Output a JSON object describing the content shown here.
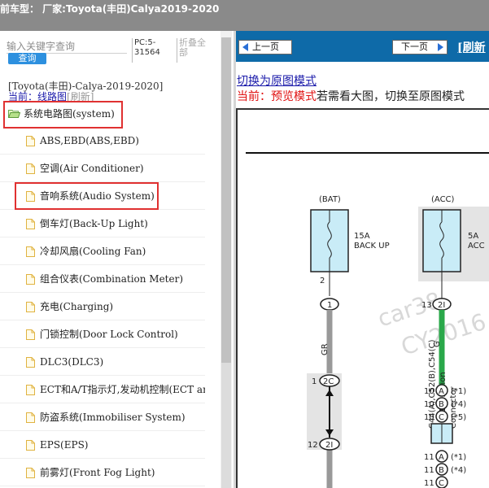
{
  "topbar": {
    "title": "前车型：  厂家:Toyota(丰田)Calya2019-2020"
  },
  "sidebar": {
    "search_placeholder": "输入关键字查询",
    "search_button": "查询",
    "pc_id": "PC:5-31564",
    "collapse_all": "折叠全部",
    "car_path": "[Toyota(丰田)-Calya-2019-2020]",
    "crumb_current_label": "当前：",
    "crumb_current": "线路图",
    "crumb_refresh": "[刷新]",
    "root": "系统电路图(system)",
    "items": [
      {
        "label": "ABS,EBD(ABS,EBD)"
      },
      {
        "label": "空调(Air Conditioner)"
      },
      {
        "label": "音响系统(Audio System)"
      },
      {
        "label": "倒车灯(Back-Up Light)"
      },
      {
        "label": "冷却风扇(Cooling Fan)"
      },
      {
        "label": "组合仪表(Combination Meter)"
      },
      {
        "label": "充电(Charging)"
      },
      {
        "label": "门锁控制(Door Lock Control)"
      },
      {
        "label": "DLC3(DLC3)"
      },
      {
        "label": "ECT和A/T指示灯,发动机控制(ECT and"
      },
      {
        "label": "防盗系统(Immobiliser System)"
      },
      {
        "label": "EPS(EPS)"
      },
      {
        "label": "前雾灯(Front Fog Light)"
      }
    ]
  },
  "viewer": {
    "prev": "上一页",
    "next": "下一页",
    "refresh": "[刷新",
    "switch_link": "切换为原图模式",
    "mode_current": "当前：",
    "mode_name": "预览模式",
    "mode_hint": "若需看大图，切换至原图模式",
    "diagram": {
      "bat_label": "(BAT)",
      "acc_label": "(ACC)",
      "fuse1_amp": "15A",
      "fuse1_name": "BACK UP",
      "fuse2_amp": "5A",
      "fuse2_name": "ACC",
      "pin_2": "2",
      "pin_13": "13",
      "pin_1": "1",
      "pin_12": "12",
      "conn_1": "1",
      "conn_2i": "2I",
      "conn_2c": "2C",
      "wire_gr": "GR",
      "wire_g": "G",
      "pin_10": "10",
      "pin_11": "11",
      "letter_a": "A",
      "letter_b": "B",
      "letter_c": "C",
      "note_1": "(*1)",
      "note_4": "(*4)",
      "note_5": "(*5)",
      "connector_label_1": "C44(A),C52(B),C54(C)",
      "connector_label_2": "No. 1 Junction",
      "connector_label_3": "Connector",
      "watermark_1": "car38",
      "watermark_2": "CY2016"
    }
  },
  "colors": {
    "accent": "#0e6aa8",
    "highlight": "#e03131",
    "wire_green": "#2aa84a",
    "fuse_fill": "#c9ecf7"
  }
}
